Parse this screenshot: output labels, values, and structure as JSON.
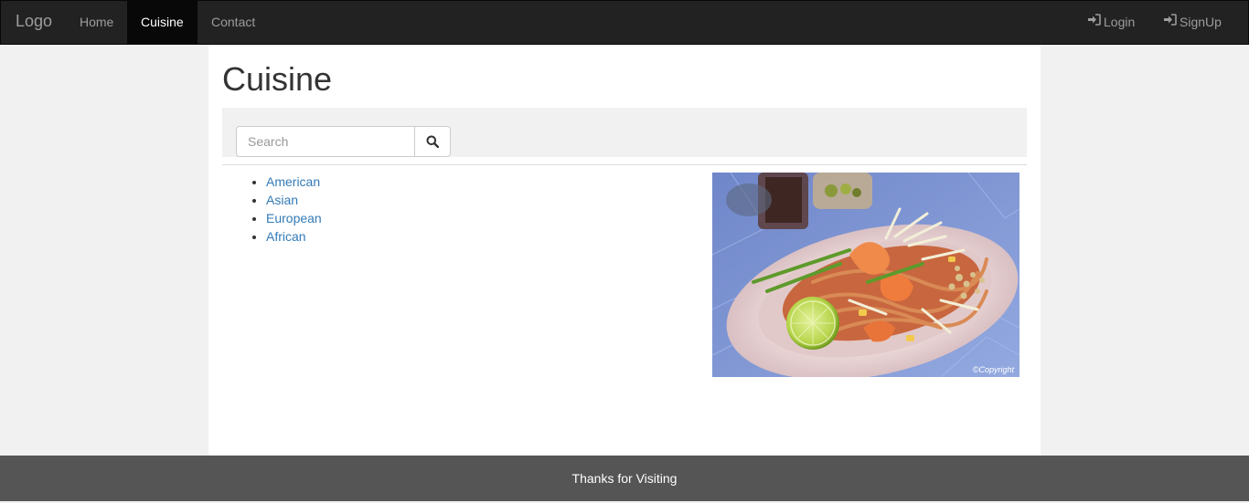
{
  "navbar": {
    "brand": "Logo",
    "links": [
      {
        "label": "Home"
      },
      {
        "label": "Cuisine",
        "active": true
      },
      {
        "label": "Contact"
      }
    ],
    "right": [
      {
        "label": "Login",
        "icon": "login-icon"
      },
      {
        "label": "SignUp",
        "icon": "login-icon"
      }
    ]
  },
  "page": {
    "title": "Cuisine"
  },
  "search": {
    "placeholder": "Search",
    "button_icon": "search-icon"
  },
  "cuisines": [
    {
      "label": "American"
    },
    {
      "label": "Asian"
    },
    {
      "label": "European"
    },
    {
      "label": "African"
    }
  ],
  "image": {
    "caption": "©Copyright",
    "subject": "pad thai shrimp dish"
  },
  "footer": {
    "text": "Thanks for Visiting"
  },
  "colors": {
    "navbar_bg": "#222222",
    "active_bg": "#080808",
    "link": "#337ab7",
    "footer_bg": "#555555",
    "page_bg": "#f1f1f1"
  }
}
